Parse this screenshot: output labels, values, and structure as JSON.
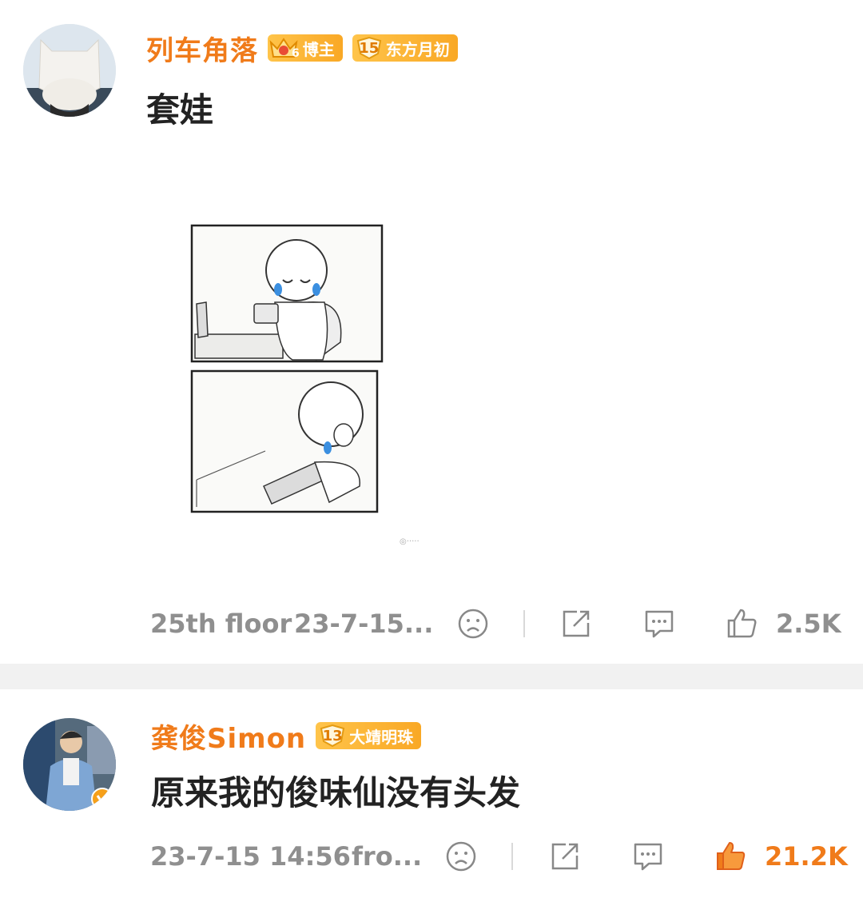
{
  "posts": [
    {
      "username": "列车角落",
      "badges": [
        {
          "type": "blogger",
          "level": "6",
          "label": "博主"
        },
        {
          "type": "fan",
          "level": "15",
          "label": "东方月初"
        }
      ],
      "text": "套娃",
      "image_icon": "comic-image",
      "meta": {
        "floor": "25th floor",
        "time": "23-7-15..."
      },
      "likes": "2.5K",
      "liked": false
    },
    {
      "username": "龚俊Simon",
      "badges": [
        {
          "type": "fan",
          "level": "13",
          "label": "大靖明珠"
        }
      ],
      "text": "原来我的俊味仙没有头发",
      "meta": {
        "time": "23-7-15 14:56",
        "source": "fro..."
      },
      "likes": "21.2K",
      "liked": true
    }
  ],
  "colors": {
    "accent": "#f07b1a",
    "badge": "#f9a825",
    "meta": "#8f8f8f"
  },
  "icons": [
    "sad-face-icon",
    "share-icon",
    "comment-icon",
    "like-icon"
  ]
}
